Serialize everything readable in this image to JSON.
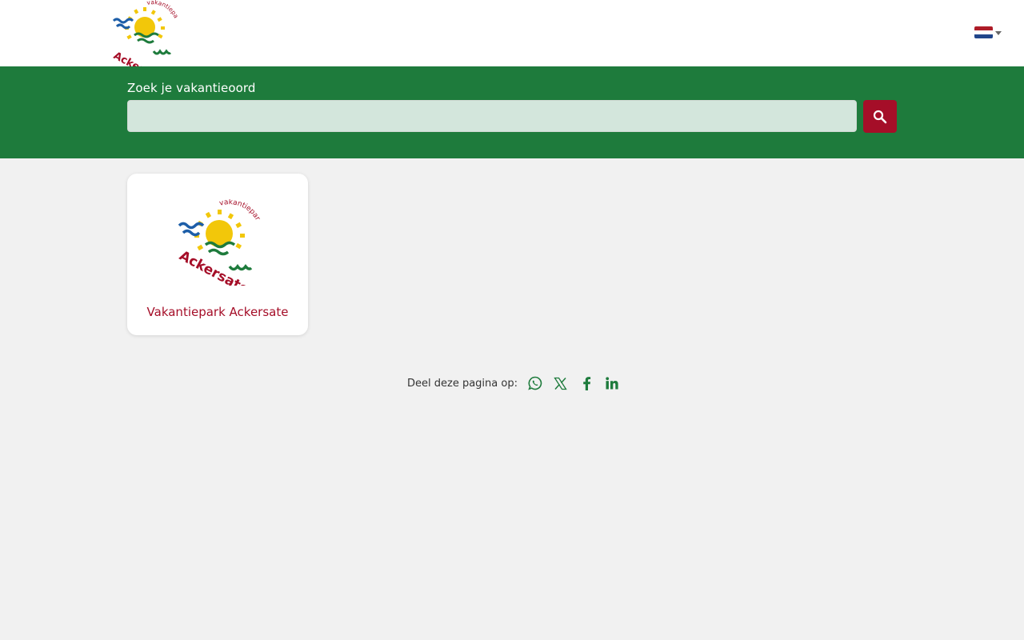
{
  "header": {
    "logo": {
      "top_text": "vakantiepark",
      "main_text": "Ackersate"
    },
    "language": {
      "flag": "flag-nl-icon",
      "colors": [
        "#ae1c28",
        "#ffffff",
        "#21468b"
      ]
    }
  },
  "search": {
    "label": "Zoek je vakantieoord",
    "value": "",
    "placeholder": "",
    "button_icon": "search-icon"
  },
  "results": [
    {
      "title": "Vakantiepark Ackersate",
      "logo": {
        "top_text": "vakantiepark",
        "main_text": "Ackersate"
      }
    }
  ],
  "share": {
    "label": "Deel deze pagina op:",
    "icons": [
      "whatsapp-icon",
      "x-icon",
      "facebook-icon",
      "linkedin-icon"
    ]
  },
  "colors": {
    "brand_green": "#1e7b3c",
    "brand_red": "#a50e28",
    "logo_yellow": "#f2c70a",
    "logo_blue": "#1d5ea8",
    "page_bg": "#f1f1f1"
  }
}
